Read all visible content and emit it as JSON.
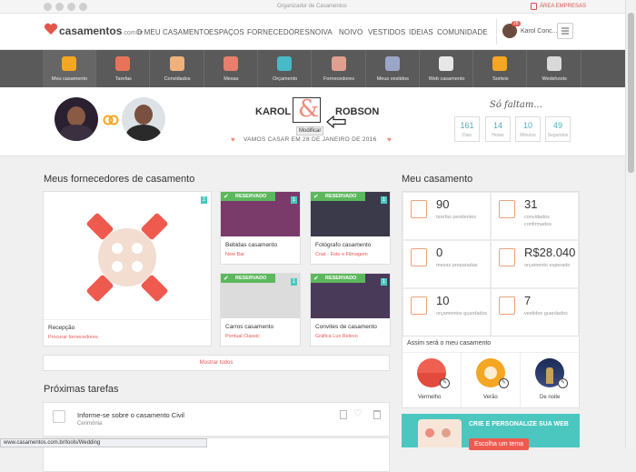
{
  "topbar": {
    "center": "Organizador de Casamentos",
    "right": "ÁREA EMPRESAS"
  },
  "header": {
    "logo": "casamentos",
    "logo_tld": ".com.br",
    "nav": [
      "O MEU CASAMENTO",
      "ESPAÇOS",
      "FORNECEDORES",
      "NOIVA",
      "NOIVO",
      "VESTIDOS",
      "IDEIAS",
      "COMUNIDADE"
    ],
    "user_name": "Karol Conc...",
    "notif_count": "28"
  },
  "iconbar": [
    {
      "label": "Meu casamento",
      "color": "#f5a623",
      "icon": "rings-icon"
    },
    {
      "label": "Tarefas",
      "color": "#e8735a",
      "icon": "clipboard-icon"
    },
    {
      "label": "Convidados",
      "color": "#f0b27a",
      "icon": "guests-icon"
    },
    {
      "label": "Mesas",
      "color": "#e87e6c",
      "icon": "table-icon"
    },
    {
      "label": "Orçamento",
      "color": "#48b9c7",
      "icon": "calculator-icon"
    },
    {
      "label": "Fornecedores",
      "color": "#e0a090",
      "icon": "book-icon"
    },
    {
      "label": "Meus vestidos",
      "color": "#9aa6c8",
      "icon": "dress-icon"
    },
    {
      "label": "Web casamento",
      "color": "#e7e7e7",
      "icon": "monitor-icon"
    },
    {
      "label": "Sorteio",
      "color": "#f5a623",
      "icon": "ticket-icon"
    },
    {
      "label": "Wedshoots",
      "color": "#d9d9d9",
      "icon": "camera-icon"
    }
  ],
  "couple": {
    "name1": "KAROL",
    "name2": "ROBSON",
    "ampersand": "&",
    "tooltip": "Modificar",
    "date_text": "VAMOS CASAR EM 28 DE JANEIRO DE 2016",
    "countdown_title": "Só faltam...",
    "countdown": [
      {
        "n": "161",
        "u": "Dias"
      },
      {
        "n": "14",
        "u": "Horas"
      },
      {
        "n": "10",
        "u": "Minutos"
      },
      {
        "n": "49",
        "u": "Segundos"
      }
    ]
  },
  "vendors": {
    "title": "Meus fornecedores de casamento",
    "first": {
      "title": "Recepção",
      "link": "Procurar fornecedores",
      "badge": "2"
    },
    "cards": [
      {
        "tag": "RESERVADO",
        "title": "Bebidas casamento",
        "sub": "New Bar",
        "badge": "1"
      },
      {
        "tag": "RESERVADO",
        "title": "Fotógrafo casamento",
        "sub": "Cnat - Foto e Filmagem",
        "badge": "1"
      },
      {
        "tag": "RESERVADO",
        "title": "Carros casamento",
        "sub": "Pontual Classic",
        "badge": "1"
      },
      {
        "tag": "RESERVADO",
        "title": "Convites de casamento",
        "sub": "Gráfica Lux Relevo",
        "badge": "1"
      }
    ],
    "show_all": "Mostrar todos"
  },
  "tasks": {
    "title": "Próximas tarefas",
    "items": [
      {
        "title": "Informe-se sobre o casamento Civil",
        "sub": "Cerimônia"
      },
      {
        "title": "...",
        "sub": ""
      }
    ]
  },
  "my_wedding": {
    "title": "Meu casamento",
    "stats": [
      {
        "num": "90",
        "label": "tarefas pendentes"
      },
      {
        "num": "31",
        "label": "convidados confirmados"
      },
      {
        "num": "0",
        "label": "mesas preparadas"
      },
      {
        "num": "R$28.040",
        "label": "orçamento esperado"
      },
      {
        "num": "10",
        "label": "orçamentos guardados"
      },
      {
        "num": "7",
        "label": "vestidos guardados"
      }
    ],
    "style_title": "Assim será o meu casamento",
    "styles": [
      "Vermelho",
      "Verão",
      "De noite"
    ],
    "promo": "CRIE E PERSONALIZE SUA WEB",
    "promo_button": "Escolha um tema"
  },
  "statusbar": "www.casamentos.com.br/tools/Wedding"
}
